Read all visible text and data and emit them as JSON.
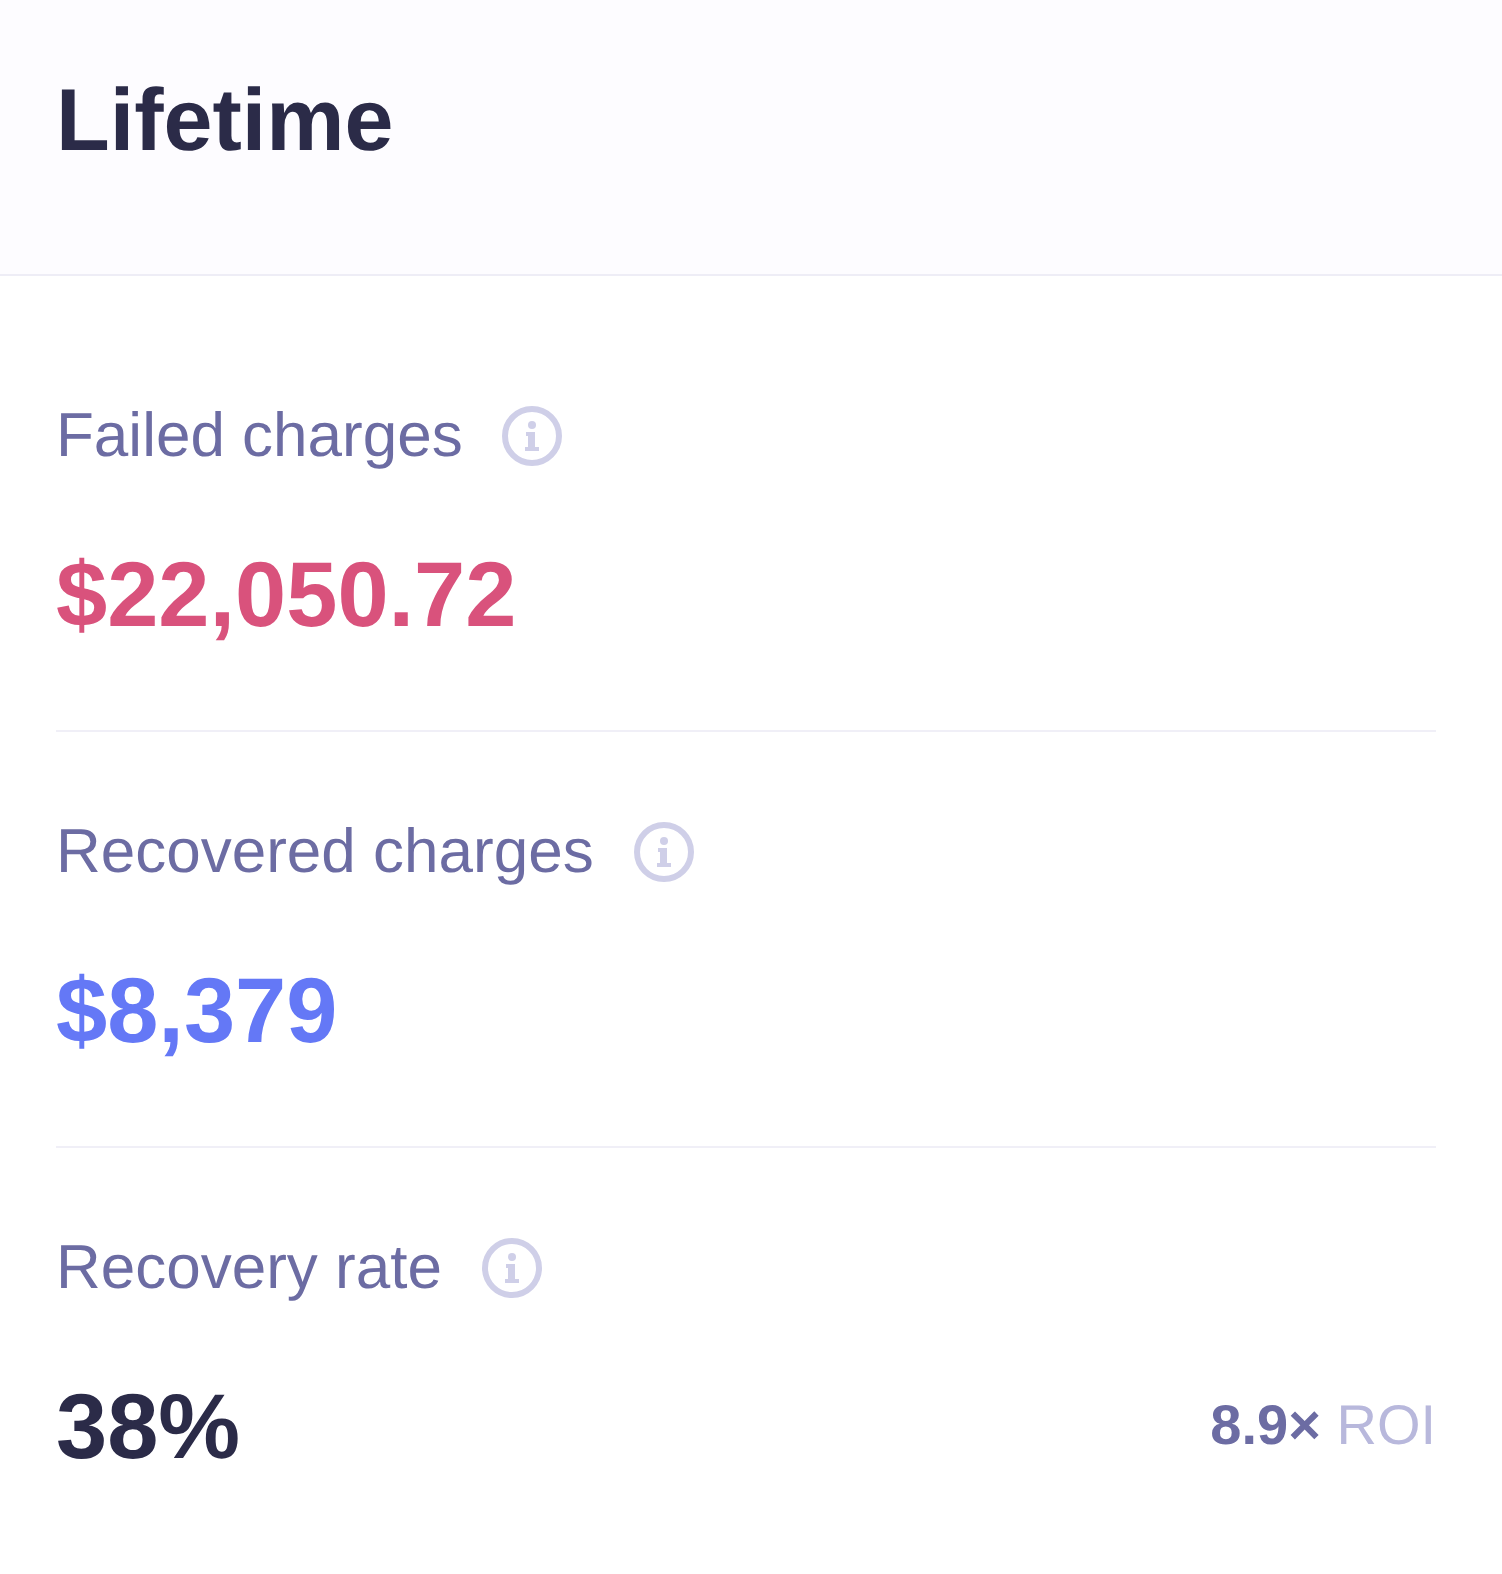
{
  "header": {
    "title": "Lifetime"
  },
  "metrics": [
    {
      "label": "Failed charges",
      "value": "$22,050.72",
      "color": "#d9527c"
    },
    {
      "label": "Recovered charges",
      "value": "$8,379",
      "color": "#6478f6"
    },
    {
      "label": "Recovery rate",
      "value": "38%",
      "color": "#2b2b48",
      "note": "**8.9×** ROI"
    }
  ]
}
